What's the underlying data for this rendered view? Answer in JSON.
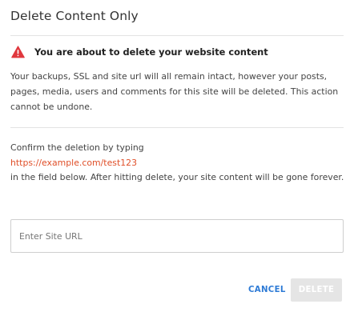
{
  "dialog": {
    "title": "Delete Content Only"
  },
  "warning": {
    "icon": "warning-triangle-icon",
    "icon_color": "#e0383e",
    "heading": "You are about to delete your website content",
    "body": "Your backups, SSL and site url will all remain intact, however your posts, pages, media, users and comments for this site will be deleted. This action cannot be undone."
  },
  "confirm": {
    "line1": "Confirm the deletion by typing",
    "url": "https://example.com/test123",
    "line3": "in the field below. After hitting delete, your site content will be gone forever."
  },
  "site_url_input": {
    "placeholder": "Enter Site URL",
    "value": ""
  },
  "actions": {
    "cancel_label": "CANCEL",
    "delete_label": "DELETE",
    "delete_enabled": false
  },
  "colors": {
    "accent": "#2e7bd6",
    "url_text": "#e0502a",
    "disabled_button": "#e5e5e5"
  }
}
